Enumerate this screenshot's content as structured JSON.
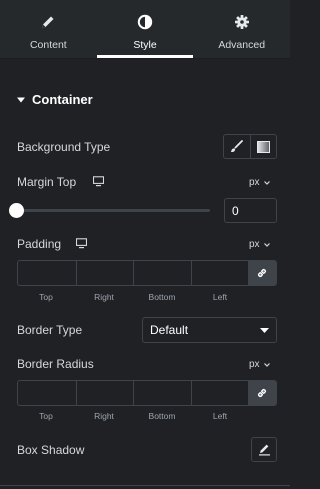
{
  "tabs": [
    {
      "label": "Content",
      "icon": "pencil-icon"
    },
    {
      "label": "Style",
      "icon": "half-circle-icon",
      "active": true
    },
    {
      "label": "Advanced",
      "icon": "gear-icon"
    }
  ],
  "section": {
    "title": "Container"
  },
  "background_type": {
    "label": "Background Type",
    "options": [
      "brush-icon",
      "gradient-icon"
    ]
  },
  "margin_top": {
    "label": "Margin Top",
    "unit": "px",
    "value": "0",
    "slider_fraction": 0
  },
  "padding": {
    "label": "Padding",
    "unit": "px",
    "sides": [
      "Top",
      "Right",
      "Bottom",
      "Left"
    ]
  },
  "border_type": {
    "label": "Border Type",
    "selected": "Default"
  },
  "border_radius": {
    "label": "Border Radius",
    "unit": "px",
    "sides": [
      "Top",
      "Right",
      "Bottom",
      "Left"
    ]
  },
  "box_shadow": {
    "label": "Box Shadow"
  },
  "colors": {
    "background": "#1f2124",
    "tabbar": "#26292c",
    "border": "#3f444b",
    "text": "#d5d8dc"
  }
}
